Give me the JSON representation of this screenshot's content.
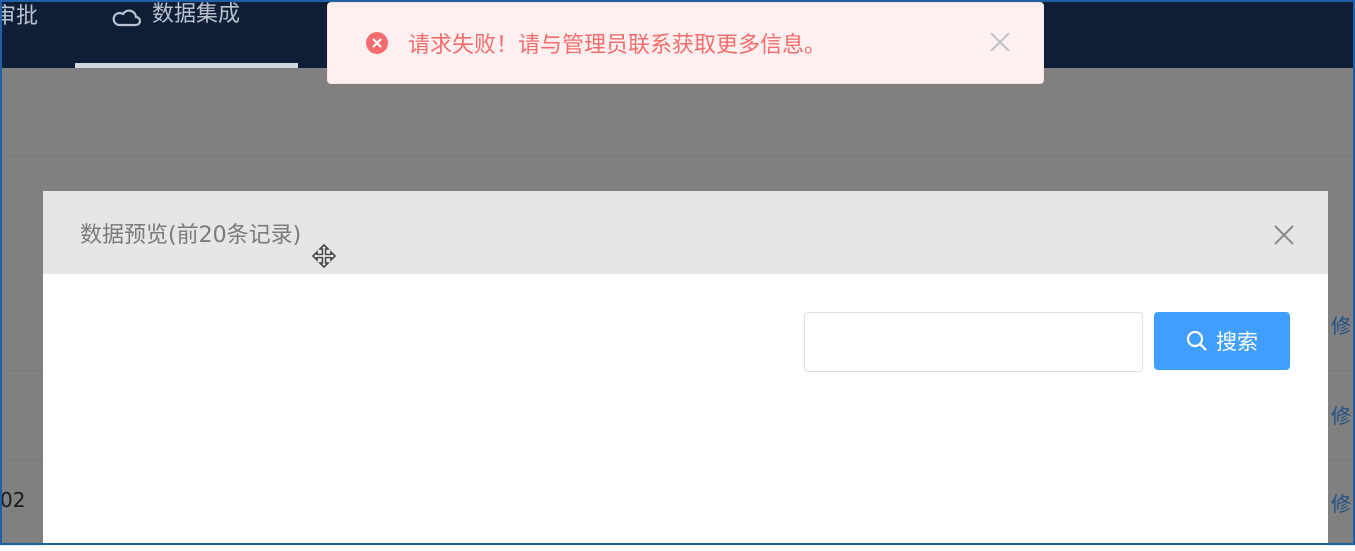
{
  "nav": {
    "left_partial_label": "审批",
    "active_label": "数据集成"
  },
  "background": {
    "row3_left_text": "02",
    "link_partial": "修"
  },
  "dialog": {
    "title": "数据预览(前20条记录)",
    "search": {
      "value": "",
      "placeholder": ""
    },
    "search_button_label": "搜索"
  },
  "toast": {
    "message": "请求失败！请与管理员联系获取更多信息。",
    "type": "error"
  },
  "colors": {
    "nav_bg": "#0f1f38",
    "primary": "#409eff",
    "error": "#f56c6c",
    "error_bg": "#fef0f0"
  }
}
